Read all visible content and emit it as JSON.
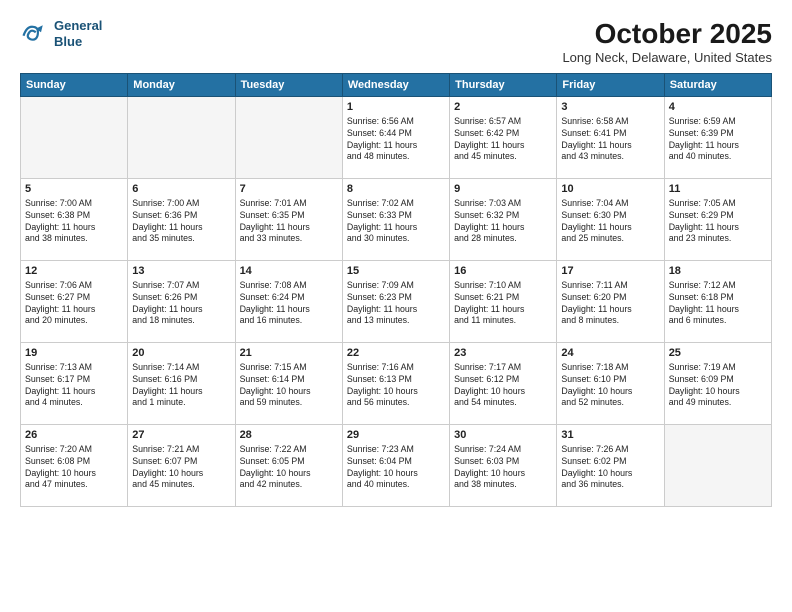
{
  "header": {
    "logo_line1": "General",
    "logo_line2": "Blue",
    "month": "October 2025",
    "location": "Long Neck, Delaware, United States"
  },
  "weekdays": [
    "Sunday",
    "Monday",
    "Tuesday",
    "Wednesday",
    "Thursday",
    "Friday",
    "Saturday"
  ],
  "weeks": [
    [
      {
        "day": "",
        "info": ""
      },
      {
        "day": "",
        "info": ""
      },
      {
        "day": "",
        "info": ""
      },
      {
        "day": "1",
        "info": "Sunrise: 6:56 AM\nSunset: 6:44 PM\nDaylight: 11 hours\nand 48 minutes."
      },
      {
        "day": "2",
        "info": "Sunrise: 6:57 AM\nSunset: 6:42 PM\nDaylight: 11 hours\nand 45 minutes."
      },
      {
        "day": "3",
        "info": "Sunrise: 6:58 AM\nSunset: 6:41 PM\nDaylight: 11 hours\nand 43 minutes."
      },
      {
        "day": "4",
        "info": "Sunrise: 6:59 AM\nSunset: 6:39 PM\nDaylight: 11 hours\nand 40 minutes."
      }
    ],
    [
      {
        "day": "5",
        "info": "Sunrise: 7:00 AM\nSunset: 6:38 PM\nDaylight: 11 hours\nand 38 minutes."
      },
      {
        "day": "6",
        "info": "Sunrise: 7:00 AM\nSunset: 6:36 PM\nDaylight: 11 hours\nand 35 minutes."
      },
      {
        "day": "7",
        "info": "Sunrise: 7:01 AM\nSunset: 6:35 PM\nDaylight: 11 hours\nand 33 minutes."
      },
      {
        "day": "8",
        "info": "Sunrise: 7:02 AM\nSunset: 6:33 PM\nDaylight: 11 hours\nand 30 minutes."
      },
      {
        "day": "9",
        "info": "Sunrise: 7:03 AM\nSunset: 6:32 PM\nDaylight: 11 hours\nand 28 minutes."
      },
      {
        "day": "10",
        "info": "Sunrise: 7:04 AM\nSunset: 6:30 PM\nDaylight: 11 hours\nand 25 minutes."
      },
      {
        "day": "11",
        "info": "Sunrise: 7:05 AM\nSunset: 6:29 PM\nDaylight: 11 hours\nand 23 minutes."
      }
    ],
    [
      {
        "day": "12",
        "info": "Sunrise: 7:06 AM\nSunset: 6:27 PM\nDaylight: 11 hours\nand 20 minutes."
      },
      {
        "day": "13",
        "info": "Sunrise: 7:07 AM\nSunset: 6:26 PM\nDaylight: 11 hours\nand 18 minutes."
      },
      {
        "day": "14",
        "info": "Sunrise: 7:08 AM\nSunset: 6:24 PM\nDaylight: 11 hours\nand 16 minutes."
      },
      {
        "day": "15",
        "info": "Sunrise: 7:09 AM\nSunset: 6:23 PM\nDaylight: 11 hours\nand 13 minutes."
      },
      {
        "day": "16",
        "info": "Sunrise: 7:10 AM\nSunset: 6:21 PM\nDaylight: 11 hours\nand 11 minutes."
      },
      {
        "day": "17",
        "info": "Sunrise: 7:11 AM\nSunset: 6:20 PM\nDaylight: 11 hours\nand 8 minutes."
      },
      {
        "day": "18",
        "info": "Sunrise: 7:12 AM\nSunset: 6:18 PM\nDaylight: 11 hours\nand 6 minutes."
      }
    ],
    [
      {
        "day": "19",
        "info": "Sunrise: 7:13 AM\nSunset: 6:17 PM\nDaylight: 11 hours\nand 4 minutes."
      },
      {
        "day": "20",
        "info": "Sunrise: 7:14 AM\nSunset: 6:16 PM\nDaylight: 11 hours\nand 1 minute."
      },
      {
        "day": "21",
        "info": "Sunrise: 7:15 AM\nSunset: 6:14 PM\nDaylight: 10 hours\nand 59 minutes."
      },
      {
        "day": "22",
        "info": "Sunrise: 7:16 AM\nSunset: 6:13 PM\nDaylight: 10 hours\nand 56 minutes."
      },
      {
        "day": "23",
        "info": "Sunrise: 7:17 AM\nSunset: 6:12 PM\nDaylight: 10 hours\nand 54 minutes."
      },
      {
        "day": "24",
        "info": "Sunrise: 7:18 AM\nSunset: 6:10 PM\nDaylight: 10 hours\nand 52 minutes."
      },
      {
        "day": "25",
        "info": "Sunrise: 7:19 AM\nSunset: 6:09 PM\nDaylight: 10 hours\nand 49 minutes."
      }
    ],
    [
      {
        "day": "26",
        "info": "Sunrise: 7:20 AM\nSunset: 6:08 PM\nDaylight: 10 hours\nand 47 minutes."
      },
      {
        "day": "27",
        "info": "Sunrise: 7:21 AM\nSunset: 6:07 PM\nDaylight: 10 hours\nand 45 minutes."
      },
      {
        "day": "28",
        "info": "Sunrise: 7:22 AM\nSunset: 6:05 PM\nDaylight: 10 hours\nand 42 minutes."
      },
      {
        "day": "29",
        "info": "Sunrise: 7:23 AM\nSunset: 6:04 PM\nDaylight: 10 hours\nand 40 minutes."
      },
      {
        "day": "30",
        "info": "Sunrise: 7:24 AM\nSunset: 6:03 PM\nDaylight: 10 hours\nand 38 minutes."
      },
      {
        "day": "31",
        "info": "Sunrise: 7:26 AM\nSunset: 6:02 PM\nDaylight: 10 hours\nand 36 minutes."
      },
      {
        "day": "",
        "info": ""
      }
    ]
  ]
}
